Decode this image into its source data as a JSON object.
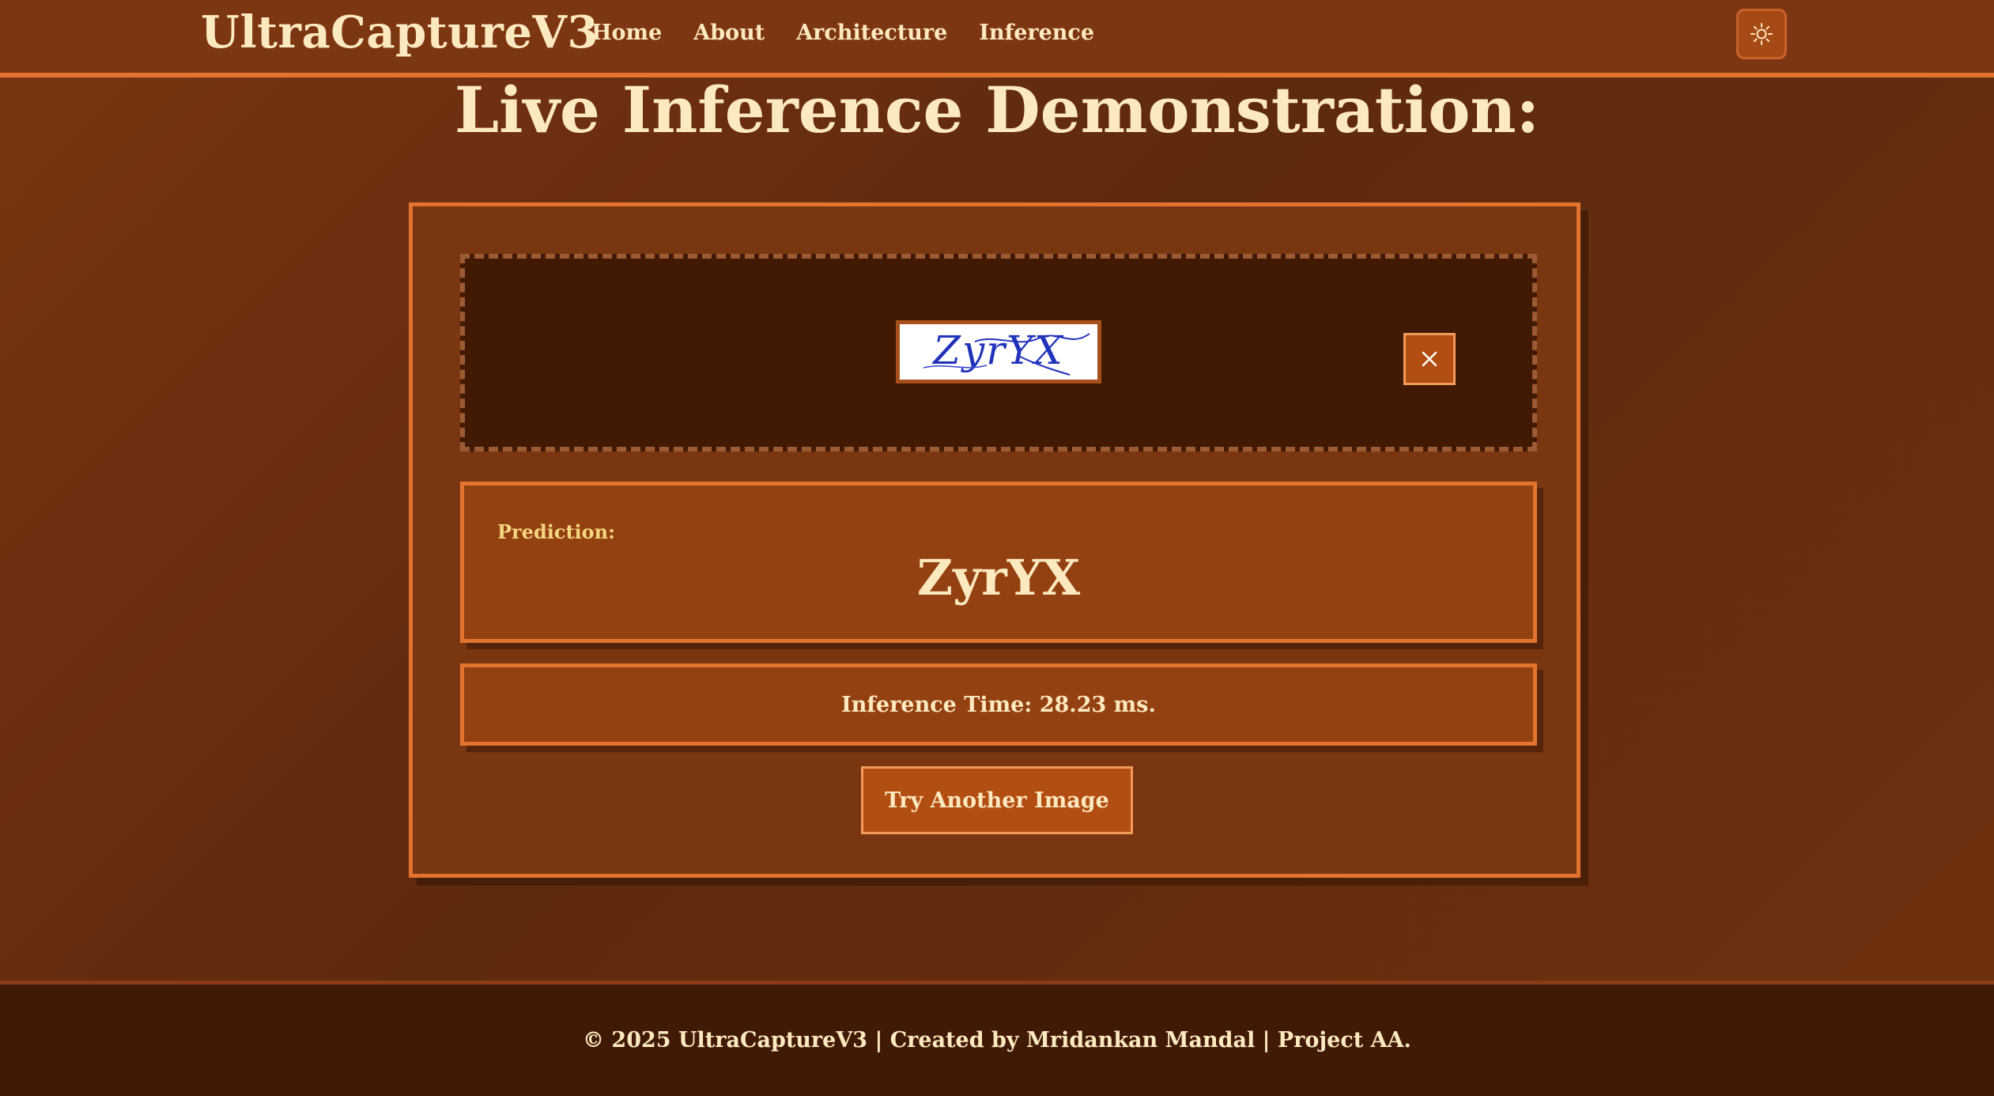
{
  "header": {
    "brand": "UltraCaptureV3",
    "nav": [
      {
        "label": "Home"
      },
      {
        "label": "About"
      },
      {
        "label": "Architecture"
      },
      {
        "label": "Inference"
      }
    ],
    "theme_toggle_icon": "sun-icon"
  },
  "main": {
    "title": "Live Inference Demonstration:",
    "upload": {
      "captcha_text": "ZyrYX",
      "remove_icon": "close-icon"
    },
    "prediction": {
      "label": "Prediction:",
      "value": "ZyrYX"
    },
    "inference_time": "Inference Time: 28.23 ms.",
    "try_button": "Try Another Image"
  },
  "footer": {
    "text": "© 2025 UltraCaptureV3 | Created by Mridankan Mandal | Project AA."
  },
  "colors": {
    "header_bg": "#7c3612",
    "accent_border": "#e3742f",
    "text_cream": "#fde9c0",
    "label_gold": "#f5d77f",
    "box_bg": "#944111",
    "button_bg": "#b24e12",
    "dropzone_bg": "#421a04",
    "footer_bg": "#411a05",
    "captcha_ink": "#2233bb"
  }
}
